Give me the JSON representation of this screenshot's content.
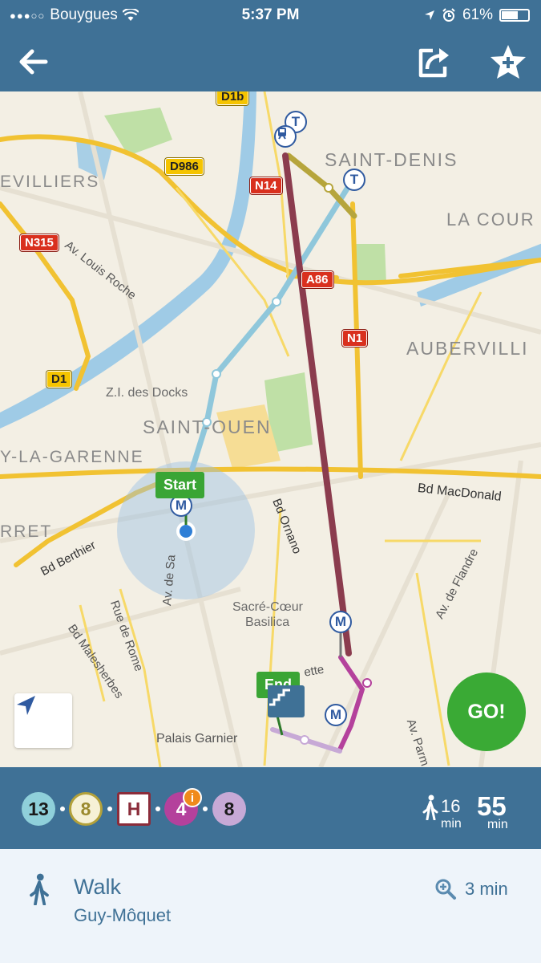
{
  "statusbar": {
    "carrier": "Bouygues",
    "time": "5:37 PM",
    "battery": "61%",
    "battery_level": 0.61
  },
  "navbar": {
    "back_icon": "arrow-left-icon",
    "share_icon": "share-icon",
    "favorite_icon": "star-plus-icon"
  },
  "map": {
    "areas": [
      "SAINT-DENIS",
      "LA COUR",
      "AUBERVILLI",
      "SAINT-OUEN",
      "EVILLIERS",
      "Y-LA-GARENNE",
      "RRET"
    ],
    "places": [
      "Z.I. des Docks",
      "Sacré-Cœur",
      "Basilica",
      "Palais Garnier"
    ],
    "streets": [
      "Av. Louis Roche",
      "Bd MacDonald",
      "Bd Berthier",
      "Bd Ornano",
      "Rue de Rome",
      "Bd Malesherbes",
      "Av. de Flandre",
      "Av. de Sa",
      "Av. Parm",
      "ette"
    ],
    "roads": [
      "D1b",
      "D986",
      "N14",
      "N315",
      "A86",
      "N1",
      "D1"
    ],
    "start_label": "Start",
    "end_label": "End",
    "metro_letter": "M",
    "tram_letter": "T",
    "go_label": "GO!"
  },
  "summary": {
    "lines": [
      {
        "label": "13",
        "bg": "#8fd0da",
        "fg": "#1a1a1a",
        "border": "#8fd0da"
      },
      {
        "label": "8",
        "bg": "#f6f1d6",
        "fg": "#9b8a2e",
        "border": "#b3a13a"
      },
      {
        "label": "H",
        "bg": "#ffffff",
        "fg": "#8b2c3a",
        "border": "#8b2c3a"
      },
      {
        "label": "4",
        "bg": "#b4419c",
        "fg": "#ffffff",
        "border": "#b4419c"
      },
      {
        "label": "8",
        "bg": "#c7a9d6",
        "fg": "#1a1a1a",
        "border": "#c7a9d6"
      }
    ],
    "walk_minutes": "16",
    "walk_unit": "min",
    "total_minutes": "55",
    "total_unit": "min"
  },
  "step": {
    "mode": "Walk",
    "stop": "Guy-Môquet",
    "duration": "3 min"
  },
  "colors": {
    "header": "#3f7196",
    "go": "#3aaa35",
    "start": "#3aa535"
  }
}
